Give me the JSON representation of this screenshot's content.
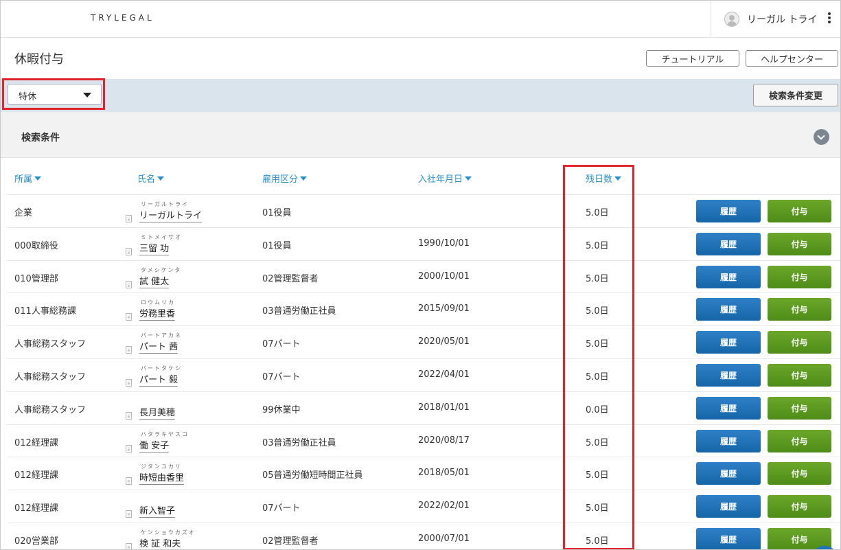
{
  "header": {
    "logo": "TRYLEGAL",
    "user_name": "リーガル トライ",
    "user_icon": "user-avatar-icon",
    "menu_icon": "kebab-menu-icon"
  },
  "page": {
    "title": "休暇付与",
    "tutorial_label": "チュートリアル",
    "help_label": "ヘルプセンター"
  },
  "filter": {
    "leave_type_selected": "特休",
    "change_conditions_label": "検索条件変更"
  },
  "search": {
    "title": "検索条件",
    "expand_icon": "chevron-down-icon"
  },
  "table": {
    "columns": {
      "dept": "所属",
      "name": "氏名",
      "employment": "雇用区分",
      "hire_date": "入社年月日",
      "remaining": "残日数"
    },
    "history_label": "履歴",
    "grant_label": "付与",
    "rows": [
      {
        "dept": "企業",
        "furigana": "リーガルトライ",
        "name": "リーガルトライ",
        "employment": "01役員",
        "hire_date": "",
        "remaining": "5.0日"
      },
      {
        "dept": "000取締役",
        "furigana": "ミトメイサオ",
        "name": "三留 功",
        "employment": "01役員",
        "hire_date": "1990/10/01",
        "remaining": "5.0日"
      },
      {
        "dept": "010管理部",
        "furigana": "タメシケンタ",
        "name": "試 健太",
        "employment": "02管理監督者",
        "hire_date": "2000/10/01",
        "remaining": "5.0日"
      },
      {
        "dept": "011人事総務課",
        "furigana": "ロウムリカ",
        "name": "労務里香",
        "employment": "03普通労働正社員",
        "hire_date": "2015/09/01",
        "remaining": "5.0日"
      },
      {
        "dept": "人事総務スタッフ",
        "furigana": "パートアカネ",
        "name": "パート 茜",
        "employment": "07パート",
        "hire_date": "2020/05/01",
        "remaining": "5.0日"
      },
      {
        "dept": "人事総務スタッフ",
        "furigana": "パートタケシ",
        "name": "パート 毅",
        "employment": "07パート",
        "hire_date": "2022/04/01",
        "remaining": "5.0日"
      },
      {
        "dept": "人事総務スタッフ",
        "furigana": "",
        "name": "長月美穂",
        "employment": "99休業中",
        "hire_date": "2018/01/01",
        "remaining": "0.0日"
      },
      {
        "dept": "012経理課",
        "furigana": "ハタラキヤスコ",
        "name": "働 安子",
        "employment": "03普通労働正社員",
        "hire_date": "2020/08/17",
        "remaining": "5.0日"
      },
      {
        "dept": "012経理課",
        "furigana": "ジタンユカリ",
        "name": "時短由香里",
        "employment": "05普通労働短時間正社員",
        "hire_date": "2018/05/01",
        "remaining": "5.0日"
      },
      {
        "dept": "012経理課",
        "furigana": "",
        "name": "新入智子",
        "employment": "07パート",
        "hire_date": "2022/02/01",
        "remaining": "5.0日"
      },
      {
        "dept": "020営業部",
        "furigana": "ケンショウカズオ",
        "name": "検 証 和夫",
        "employment": "02管理監督者",
        "hire_date": "2000/07/01",
        "remaining": "5.0日"
      }
    ]
  },
  "colors": {
    "accent_link": "#2a8fc8",
    "history_button": "#1a6db3",
    "grant_button": "#5a9a20",
    "highlight_box": "#e0242c",
    "filter_bar": "#d9e4ec"
  }
}
